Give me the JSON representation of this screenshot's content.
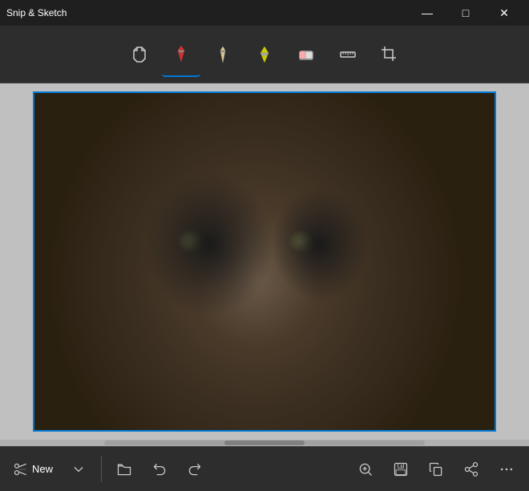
{
  "app": {
    "title": "Snip & Sketch"
  },
  "titlebar": {
    "minimize_label": "—",
    "maximize_label": "□",
    "close_label": "✕"
  },
  "toolbar": {
    "tools": [
      {
        "id": "touch-writing",
        "label": "Touch Writing",
        "active": false,
        "icon": "touch-write"
      },
      {
        "id": "ballpoint-pen",
        "label": "Ballpoint Pen",
        "active": true,
        "icon": "pen"
      },
      {
        "id": "pencil",
        "label": "Pencil",
        "active": false,
        "icon": "pencil"
      },
      {
        "id": "highlighter",
        "label": "Highlighter",
        "active": false,
        "icon": "highlighter"
      },
      {
        "id": "eraser",
        "label": "Eraser",
        "active": false,
        "icon": "eraser"
      },
      {
        "id": "ruler",
        "label": "Ruler",
        "active": false,
        "icon": "ruler"
      },
      {
        "id": "crop",
        "label": "Crop & Annotate",
        "active": false,
        "icon": "crop"
      }
    ]
  },
  "bottombar": {
    "new_label": "New",
    "buttons": [
      {
        "id": "new",
        "label": "New",
        "icon": "scissors"
      },
      {
        "id": "new-dropdown",
        "label": "",
        "icon": "chevron-down"
      },
      {
        "id": "open",
        "label": "",
        "icon": "folder"
      },
      {
        "id": "undo",
        "label": "",
        "icon": "undo"
      },
      {
        "id": "redo",
        "label": "",
        "icon": "redo"
      },
      {
        "id": "zoom-in",
        "label": "",
        "icon": "zoom-in"
      },
      {
        "id": "save",
        "label": "",
        "icon": "save"
      },
      {
        "id": "copy",
        "label": "",
        "icon": "copy"
      },
      {
        "id": "share",
        "label": "",
        "icon": "share"
      },
      {
        "id": "more",
        "label": "",
        "icon": "more"
      }
    ]
  }
}
